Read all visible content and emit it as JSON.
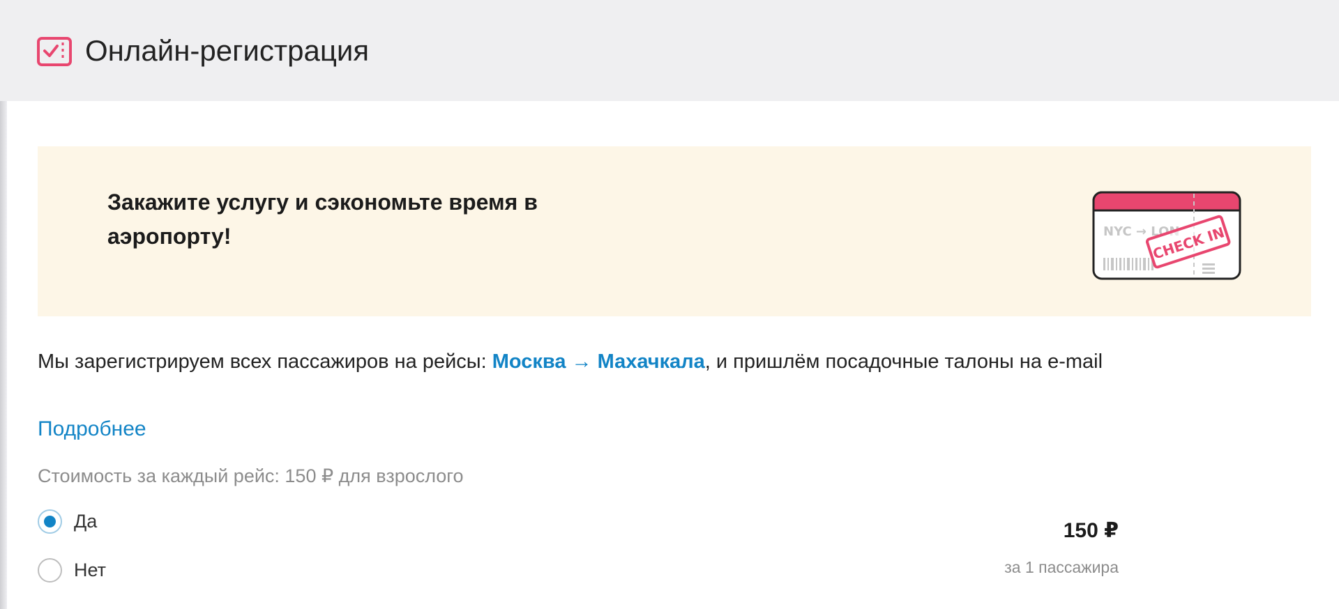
{
  "header": {
    "title": "Онлайн-регистрация",
    "icon": "ticket-check-icon"
  },
  "promo": {
    "text": "Закажите услугу и сэкономьте время в аэропорту!",
    "ticket": {
      "icon": "check-in-ticket-icon",
      "route_text": "NYC → LON",
      "stamp_text": "CHECK IN"
    }
  },
  "description": {
    "prefix": "Мы зарегистрируем всех пассажиров на рейсы: ",
    "route": "Москва → Махачкала",
    "suffix": ", и пришлём посадочные талоны на e-mail"
  },
  "more_link": "Подробнее",
  "price_note": "Стоимость за каждый рейс: 150 ₽ для взрослого",
  "options": [
    {
      "label": "Да",
      "selected": true
    },
    {
      "label": "Нет",
      "selected": false
    }
  ],
  "price": {
    "amount": "150 ₽",
    "per": "за 1 пассажира"
  },
  "colors": {
    "accent": "#1284c6",
    "brand_pink": "#e8466f",
    "header_bg": "#efeff1",
    "promo_bg": "#fdf6e7"
  }
}
